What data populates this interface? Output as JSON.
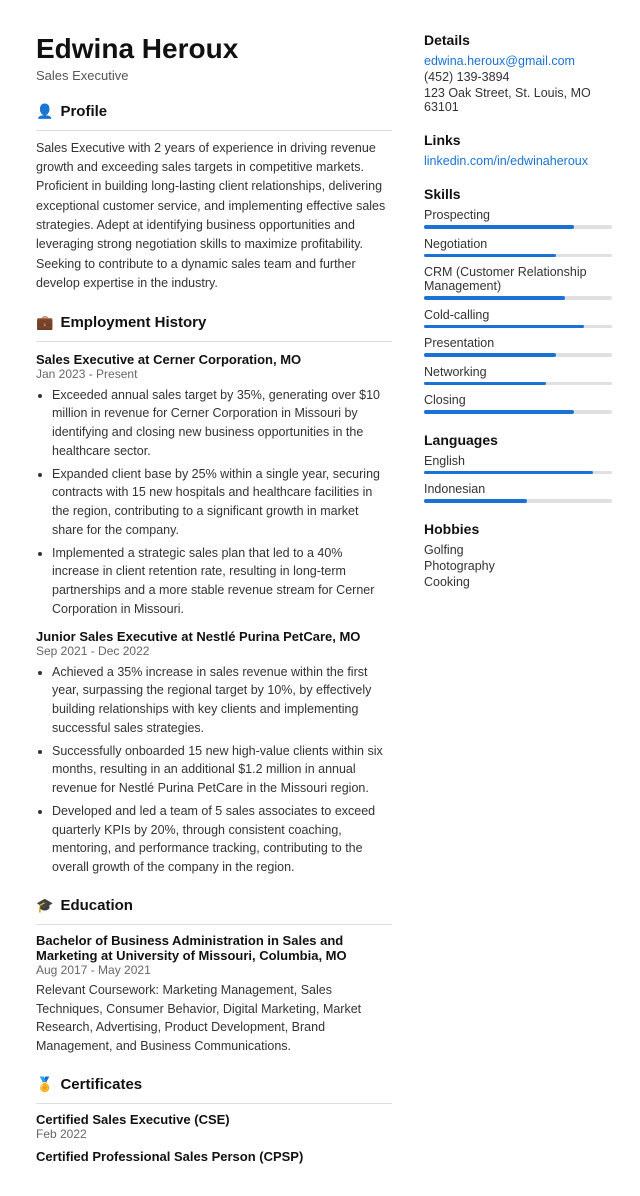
{
  "header": {
    "name": "Edwina Heroux",
    "subtitle": "Sales Executive"
  },
  "profile": {
    "section_title": "Profile",
    "icon": "👤",
    "text": "Sales Executive with 2 years of experience in driving revenue growth and exceeding sales targets in competitive markets. Proficient in building long-lasting client relationships, delivering exceptional customer service, and implementing effective sales strategies. Adept at identifying business opportunities and leveraging strong negotiation skills to maximize profitability. Seeking to contribute to a dynamic sales team and further develop expertise in the industry."
  },
  "employment": {
    "section_title": "Employment History",
    "icon": "💼",
    "jobs": [
      {
        "title": "Sales Executive at Cerner Corporation, MO",
        "date": "Jan 2023 - Present",
        "bullets": [
          "Exceeded annual sales target by 35%, generating over $10 million in revenue for Cerner Corporation in Missouri by identifying and closing new business opportunities in the healthcare sector.",
          "Expanded client base by 25% within a single year, securing contracts with 15 new hospitals and healthcare facilities in the region, contributing to a significant growth in market share for the company.",
          "Implemented a strategic sales plan that led to a 40% increase in client retention rate, resulting in long-term partnerships and a more stable revenue stream for Cerner Corporation in Missouri."
        ]
      },
      {
        "title": "Junior Sales Executive at Nestlé Purina PetCare, MO",
        "date": "Sep 2021 - Dec 2022",
        "bullets": [
          "Achieved a 35% increase in sales revenue within the first year, surpassing the regional target by 10%, by effectively building relationships with key clients and implementing successful sales strategies.",
          "Successfully onboarded 15 new high-value clients within six months, resulting in an additional $1.2 million in annual revenue for Nestlé Purina PetCare in the Missouri region.",
          "Developed and led a team of 5 sales associates to exceed quarterly KPIs by 20%, through consistent coaching, mentoring, and performance tracking, contributing to the overall growth of the company in the region."
        ]
      }
    ]
  },
  "education": {
    "section_title": "Education",
    "icon": "🎓",
    "items": [
      {
        "title": "Bachelor of Business Administration in Sales and Marketing at University of Missouri, Columbia, MO",
        "date": "Aug 2017 - May 2021",
        "text": "Relevant Coursework: Marketing Management, Sales Techniques, Consumer Behavior, Digital Marketing, Market Research, Advertising, Product Development, Brand Management, and Business Communications."
      }
    ]
  },
  "certificates": {
    "section_title": "Certificates",
    "icon": "🏅",
    "items": [
      {
        "title": "Certified Sales Executive (CSE)",
        "date": "Feb 2022"
      },
      {
        "title": "Certified Professional Sales Person (CPSP)",
        "date": ""
      }
    ]
  },
  "details": {
    "section_title": "Details",
    "email": "edwina.heroux@gmail.com",
    "phone": "(452) 139-3894",
    "address": "123 Oak Street, St. Louis, MO 63101"
  },
  "links": {
    "section_title": "Links",
    "linkedin": "linkedin.com/in/edwinaheroux"
  },
  "skills": {
    "section_title": "Skills",
    "items": [
      {
        "name": "Prospecting",
        "pct": 80
      },
      {
        "name": "Negotiation",
        "pct": 70
      },
      {
        "name": "CRM (Customer Relationship Management)",
        "pct": 75
      },
      {
        "name": "Cold-calling",
        "pct": 85
      },
      {
        "name": "Presentation",
        "pct": 70
      },
      {
        "name": "Networking",
        "pct": 65
      },
      {
        "name": "Closing",
        "pct": 80
      }
    ]
  },
  "languages": {
    "section_title": "Languages",
    "items": [
      {
        "name": "English",
        "pct": 90
      },
      {
        "name": "Indonesian",
        "pct": 55
      }
    ]
  },
  "hobbies": {
    "section_title": "Hobbies",
    "items": [
      "Golfing",
      "Photography",
      "Cooking"
    ]
  }
}
